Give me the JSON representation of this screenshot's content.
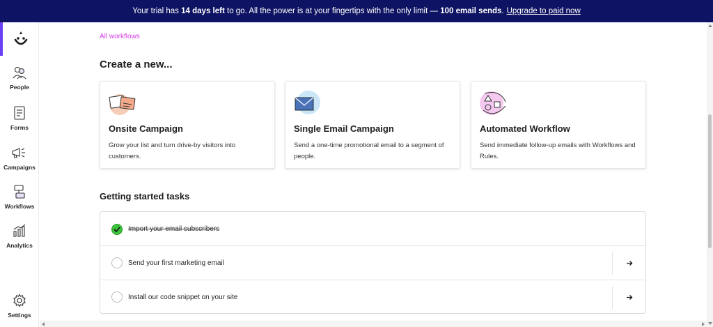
{
  "banner": {
    "text_1": "Your trial has",
    "bold_1": "14 days left",
    "text_2": "to go. All the power is at your fingertips with the only limit —",
    "bold_2": "100 email sends",
    "text_3": ".",
    "upgrade_link": "Upgrade to paid now",
    "bg_color": "#0e1463"
  },
  "sidebar": {
    "logo_icon": "smiley-logo-icon",
    "active_indicator_color": "#6b3ff2",
    "items": [
      {
        "label": "People",
        "icon": "people-icon"
      },
      {
        "label": "Forms",
        "icon": "forms-icon"
      },
      {
        "label": "Campaigns",
        "icon": "megaphone-icon"
      },
      {
        "label": "Workflows",
        "icon": "workflow-icon"
      },
      {
        "label": "Analytics",
        "icon": "analytics-icon"
      }
    ],
    "settings": {
      "label": "Settings",
      "icon": "gear-icon"
    }
  },
  "main": {
    "breadcrumb": "All workflows",
    "breadcrumb_color": "#d23ce3",
    "create_title": "Create a new...",
    "cards": [
      {
        "title": "Onsite Campaign",
        "description": "Grow your list and turn drive-by visitors into customers.",
        "icon": "onsite-campaign-illustration"
      },
      {
        "title": "Single Email Campaign",
        "description": "Send a one-time promotional email to a segment of people.",
        "icon": "email-envelope-illustration"
      },
      {
        "title": "Automated Workflow",
        "description": "Send immediate follow-up emails with Workflows and Rules.",
        "icon": "automated-workflow-illustration"
      }
    ],
    "tasks_title": "Getting started tasks",
    "tasks": [
      {
        "label": "Import your email subscribers",
        "done": true
      },
      {
        "label": "Send your first marketing email",
        "done": false
      },
      {
        "label": "Install our code snippet on your site",
        "done": false
      }
    ]
  }
}
